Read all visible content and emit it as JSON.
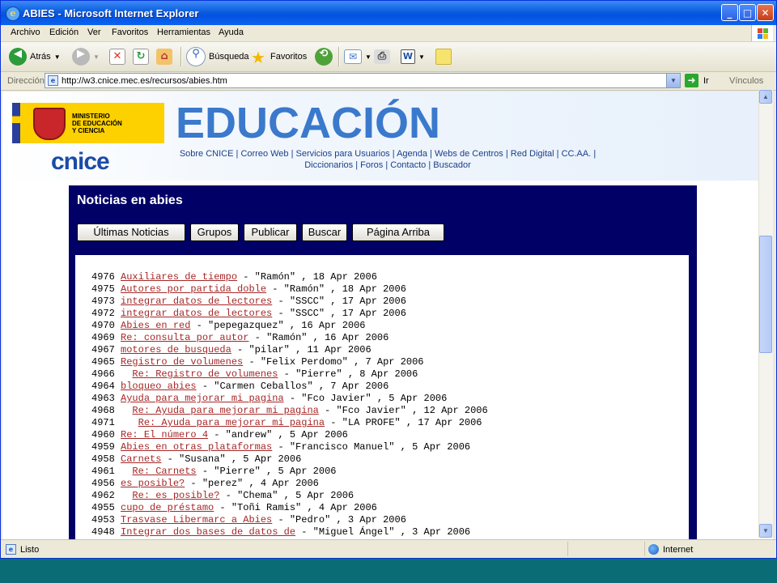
{
  "window": {
    "title": "ABIES - Microsoft Internet Explorer",
    "controls": {
      "minimize": "_",
      "maximize": "□",
      "close": "✕"
    }
  },
  "menu": [
    "Archivo",
    "Edición",
    "Ver",
    "Favoritos",
    "Herramientas",
    "Ayuda"
  ],
  "toolbar": {
    "back_label": "Atrás",
    "search_label": "Búsqueda",
    "favorites_label": "Favoritos"
  },
  "address": {
    "label": "Dirección",
    "url": "http://w3.cnice.mec.es/recursos/abies.htm",
    "go_label": "Ir",
    "links_label": "Vínculos"
  },
  "header": {
    "ministerio_lines": [
      "MINISTERIO",
      "DE EDUCACIÓN",
      "Y CIENCIA"
    ],
    "logo_text": "cnice",
    "banner_text": "EDUCACIÓN",
    "links_row1": [
      "Sobre CNICE",
      "Correo Web",
      "Servicios para Usuarios",
      "Agenda",
      "Webs de Centros",
      "Red Digital",
      "CC.AA."
    ],
    "links_row2": [
      "Diccionarios",
      "Foros",
      "Contacto",
      "Buscador"
    ]
  },
  "panel": {
    "title": "Noticias en abies",
    "buttons": [
      "Últimas Noticias",
      "Grupos",
      "Publicar",
      "Buscar",
      "Página Arriba"
    ]
  },
  "posts": [
    {
      "id": "4976",
      "indent": 0,
      "subject": "Auxiliares de tiempo",
      "author": "\"Ramón\"",
      "date": "18 Apr 2006"
    },
    {
      "id": "4975",
      "indent": 0,
      "subject": "Autores por partida doble",
      "author": "\"Ramón\"",
      "date": "18 Apr 2006"
    },
    {
      "id": "4973",
      "indent": 0,
      "subject": "integrar datos de lectores",
      "author": "\"SSCC\"",
      "date": "17 Apr 2006"
    },
    {
      "id": "4972",
      "indent": 0,
      "subject": "integrar datos de lectores",
      "author": "\"SSCC\"",
      "date": "17 Apr 2006"
    },
    {
      "id": "4970",
      "indent": 0,
      "subject": "Abies en red",
      "author": "\"pepegazquez\"",
      "date": "16 Apr 2006"
    },
    {
      "id": "4969",
      "indent": 0,
      "subject": "Re: consulta por autor",
      "author": "\"Ramón\"",
      "date": "16 Apr 2006"
    },
    {
      "id": "4967",
      "indent": 0,
      "subject": "motores de busqueda",
      "author": "\"pilar\"",
      "date": "11 Apr 2006"
    },
    {
      "id": "4965",
      "indent": 0,
      "subject": "Registro de volumenes",
      "author": "\"Felix Perdomo\"",
      "date": "7 Apr 2006"
    },
    {
      "id": "4966",
      "indent": 2,
      "subject": "Re: Registro de volumenes",
      "author": "\"Pierre\"",
      "date": "8 Apr 2006"
    },
    {
      "id": "4964",
      "indent": 0,
      "subject": "bloqueo abies",
      "author": "\"Carmen Ceballos\"",
      "date": "7 Apr 2006"
    },
    {
      "id": "4963",
      "indent": 0,
      "subject": "Ayuda para mejorar mi pagina",
      "author": "\"Fco Javier\"",
      "date": "5 Apr 2006"
    },
    {
      "id": "4968",
      "indent": 2,
      "subject": "Re: Ayuda para mejorar mi pagina",
      "author": "\"Fco Javier\"",
      "date": "12 Apr 2006"
    },
    {
      "id": "4971",
      "indent": 3,
      "subject": "Re: Ayuda para mejorar mi pagina",
      "author": "\"LA PROFE\"",
      "date": "17 Apr 2006"
    },
    {
      "id": "4960",
      "indent": 0,
      "subject": "Re: El número 4",
      "author": "\"andrew\"",
      "date": "5 Apr 2006"
    },
    {
      "id": "4959",
      "indent": 0,
      "subject": "Abies en otras plataformas",
      "author": "\"Francisco Manuel\"",
      "date": "5 Apr 2006"
    },
    {
      "id": "4958",
      "indent": 0,
      "subject": "Carnets",
      "author": "\"Susana\"",
      "date": "5 Apr 2006"
    },
    {
      "id": "4961",
      "indent": 2,
      "subject": "Re: Carnets",
      "author": "\"Pierre\"",
      "date": "5 Apr 2006"
    },
    {
      "id": "4956",
      "indent": 0,
      "subject": "es posible?",
      "author": "\"perez\"",
      "date": "4 Apr 2006"
    },
    {
      "id": "4962",
      "indent": 2,
      "subject": "Re: es posible?",
      "author": "\"Chema\"",
      "date": "5 Apr 2006"
    },
    {
      "id": "4955",
      "indent": 0,
      "subject": "cupo de préstamo",
      "author": "\"Toñi Ramis\"",
      "date": "4 Apr 2006"
    },
    {
      "id": "4953",
      "indent": 0,
      "subject": "Trasvase Libermarc a Abies",
      "author": "\"Pedro\"",
      "date": "3 Apr 2006"
    },
    {
      "id": "4948",
      "indent": 0,
      "subject": "Integrar dos bases de datos de",
      "author": "\"Miguel Ángel\"",
      "date": "3 Apr 2006"
    }
  ],
  "status": {
    "text": "Listo",
    "zone": "Internet"
  },
  "colors": {
    "panel_bg": "#000066",
    "link": "#a52828",
    "titlebar": "#0a5ede"
  }
}
